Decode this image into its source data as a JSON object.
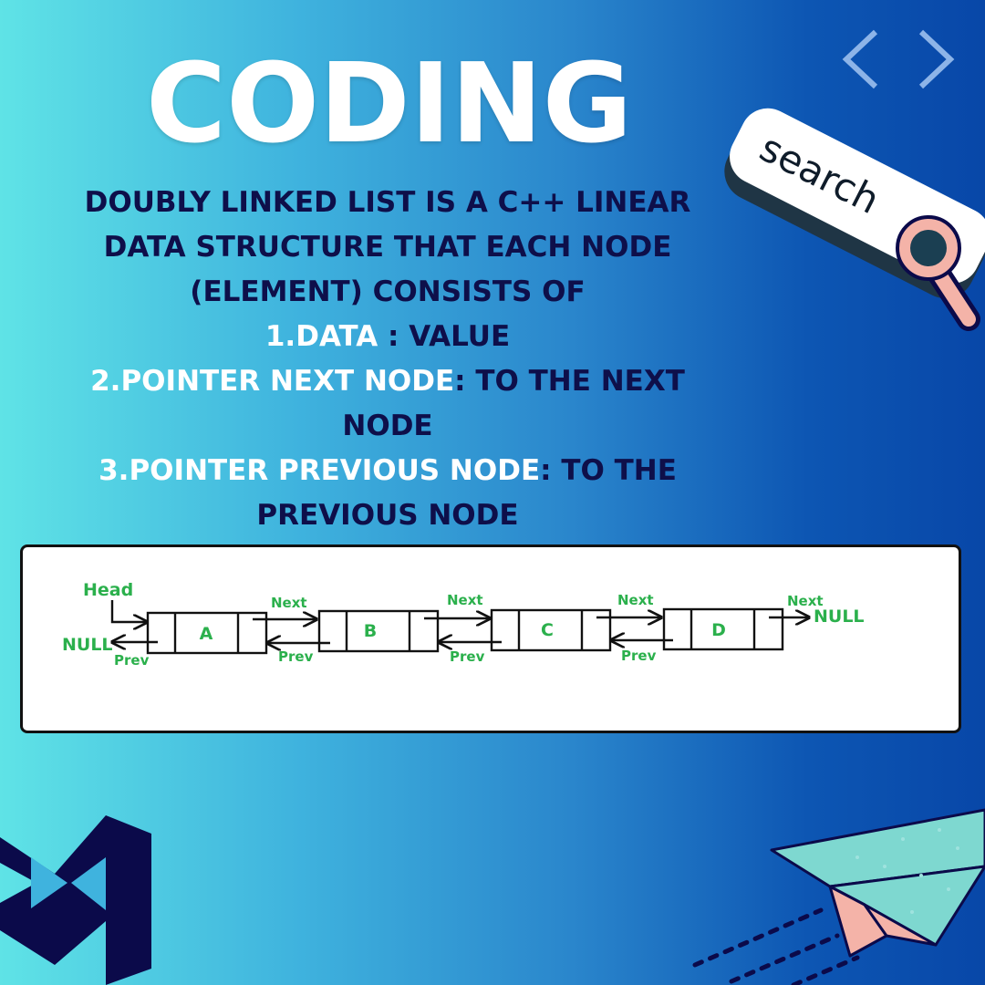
{
  "title": "CODING",
  "description": {
    "line1": "DOUBLY LINKED LIST IS A C++ LINEAR",
    "line2": "DATA STRUCTURE  THAT EACH NODE",
    "line3": "(ELEMENT) CONSISTS OF",
    "item1_label": "1.DATA",
    "item1_rest": " : VALUE",
    "item2_label": "2.POINTER NEXT NODE",
    "item2_rest": ": TO THE NEXT",
    "item2_cont": "NODE",
    "item3_label": "3.POINTER PREVIOUS NODE",
    "item3_rest": ": TO THE",
    "item3_cont": "PREVIOUS NODE"
  },
  "search_widget": {
    "text": "search"
  },
  "diagram": {
    "head_label": "Head",
    "null_left": "NULL",
    "null_right": "NULL",
    "next_label": "Next",
    "prev_label": "Prev",
    "nodes": [
      "A",
      "B",
      "C",
      "D"
    ]
  },
  "colors": {
    "title": "#ffffff",
    "text_dark": "#0e0f4a",
    "highlight": "#ffffff",
    "diagram_label": "#2bb04c",
    "icon_navy": "#0b0a4a",
    "pink": "#f4b3a8",
    "teal": "#7ed8d0"
  },
  "icons": [
    "chevron-left-icon",
    "chevron-right-icon",
    "search-icon",
    "visual-studio-logo-icon",
    "paper-plane-icon"
  ]
}
